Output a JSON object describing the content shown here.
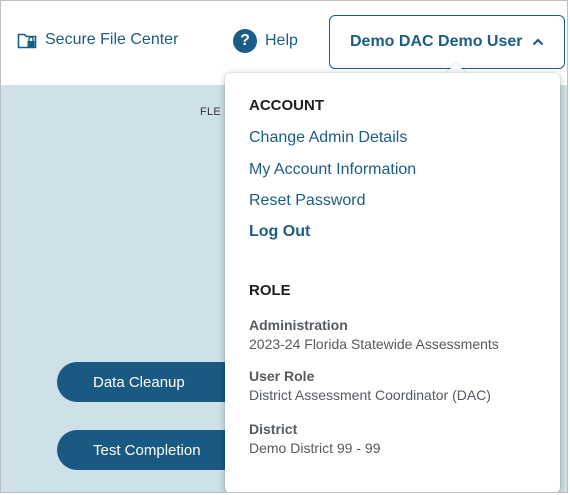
{
  "nav": {
    "secure_file_center": "Secure File Center",
    "help": "Help",
    "user_name": "Demo DAC Demo User"
  },
  "main": {
    "fle_text": "FLE",
    "buttons": {
      "data_cleanup": "Data Cleanup",
      "test_completion": "Test Completion"
    }
  },
  "dropdown": {
    "account_heading": "ACCOUNT",
    "links": [
      "Change Admin Details",
      "My Account Information",
      "Reset Password",
      "Log Out"
    ],
    "role_heading": "ROLE",
    "role_items": [
      {
        "label": "Administration",
        "value": "2023-24 Florida Statewide Assessments"
      },
      {
        "label": "User Role",
        "value": "District Assessment Coordinator (DAC)"
      },
      {
        "label": "District",
        "value": "Demo District 99 - 99"
      }
    ]
  },
  "colors": {
    "brand_blue": "#1a5d86",
    "background": "#cfe1e8",
    "button_fill": "#1a5a82"
  },
  "icons": [
    "folder-lock-icon",
    "help-icon",
    "chevron-up-icon"
  ]
}
